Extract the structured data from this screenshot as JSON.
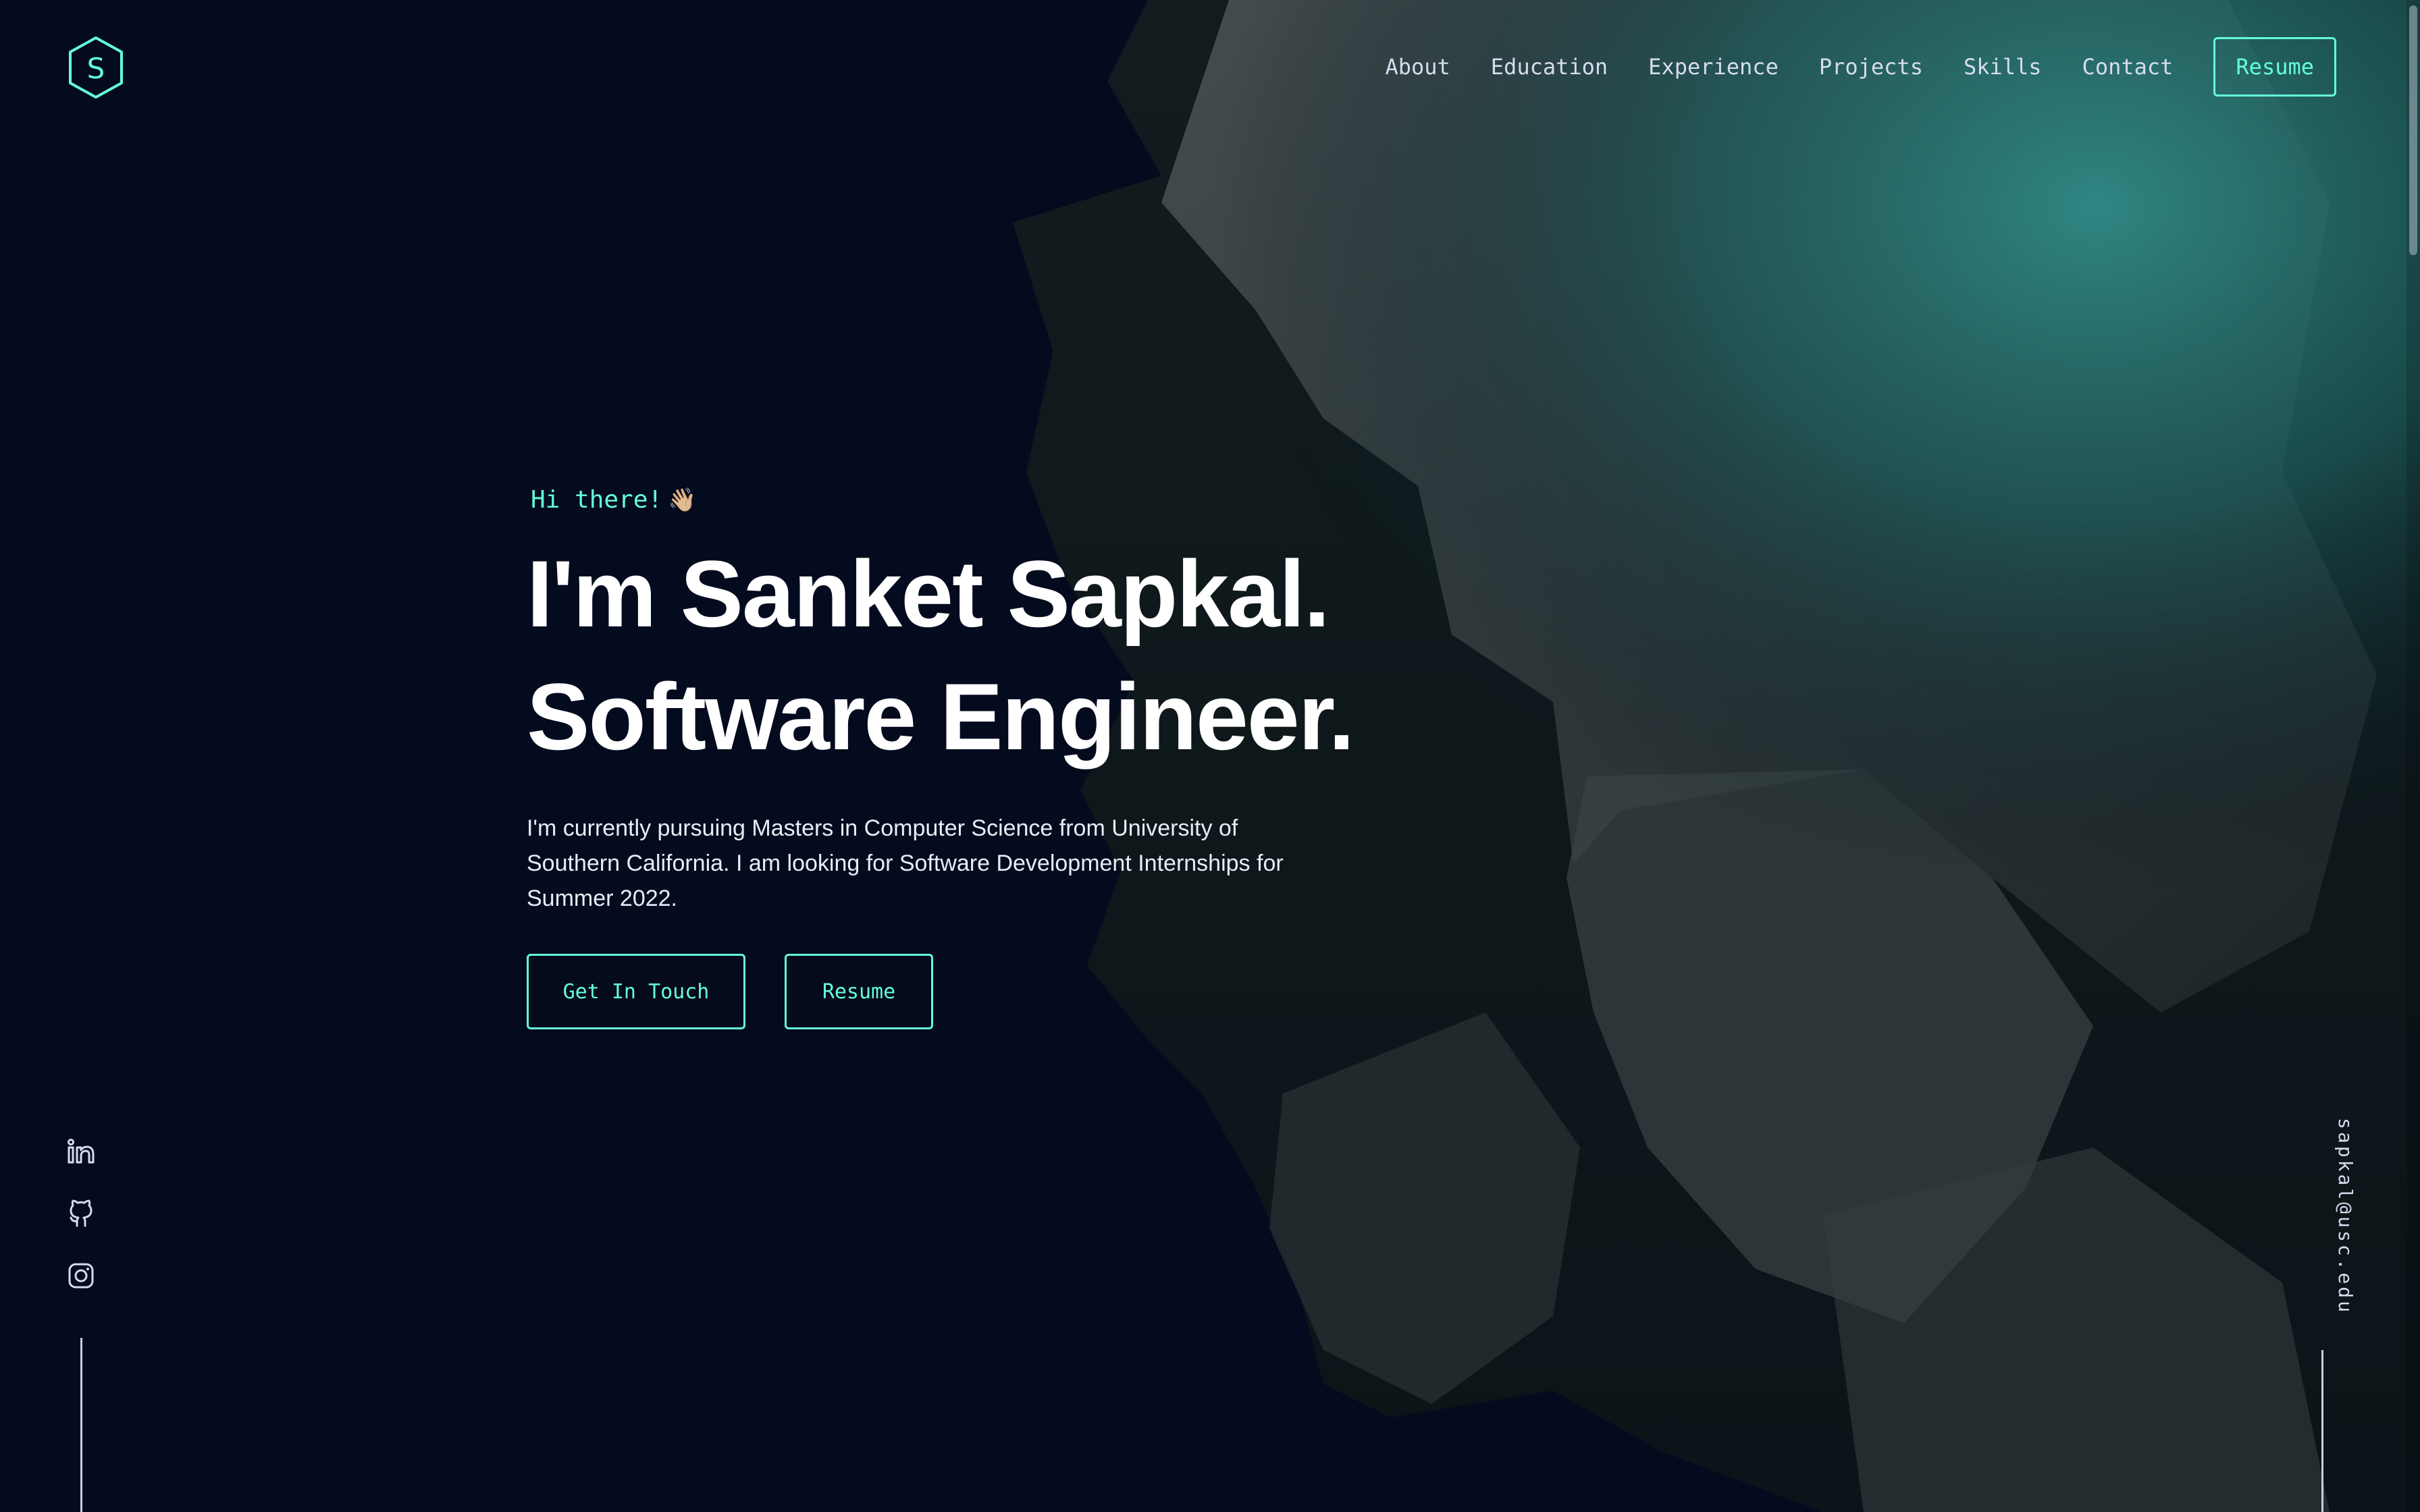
{
  "nav": {
    "logo_letter": "S",
    "links": [
      "About",
      "Education",
      "Experience",
      "Projects",
      "Skills",
      "Contact"
    ],
    "resume_label": "Resume"
  },
  "hero": {
    "greeting": "Hi there!",
    "wave_emoji": "👋🏼",
    "headline_line1": "I'm Sanket Sapkal.",
    "headline_line2": "Software Engineer.",
    "intro": "I'm currently pursuing Masters in Computer Science from University of Southern California. I am looking for Software Development Internships for Summer 2022.",
    "cta_primary": "Get In Touch",
    "cta_secondary": "Resume"
  },
  "social": {
    "icons": [
      "linkedin-icon",
      "github-icon",
      "instagram-icon"
    ]
  },
  "email": "sapkal@usc.edu",
  "colors": {
    "background": "#050b1e",
    "accent": "#64ffda",
    "text": "#ffffff",
    "nav_text": "#d6dcef"
  }
}
